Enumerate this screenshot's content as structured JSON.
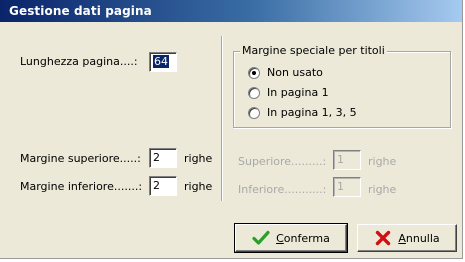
{
  "window": {
    "title": "Gestione dati pagina"
  },
  "left": {
    "page_length_label": "Lunghezza pagina....:",
    "page_length_value": "64",
    "top_margin_label": "Margine superiore.....:",
    "top_margin_value": "2",
    "top_margin_unit": "righe",
    "bottom_margin_label": "Margine inferiore.......:",
    "bottom_margin_value": "2",
    "bottom_margin_unit": "righe"
  },
  "right": {
    "group_title": "Margine speciale per titoli",
    "options": [
      {
        "label": "Non usato",
        "checked": true
      },
      {
        "label": "In pagina 1",
        "checked": false
      },
      {
        "label": "In pagina 1, 3, 5",
        "checked": false
      }
    ],
    "superiore_label": "Superiore.........:",
    "superiore_value": "1",
    "superiore_unit": "righe",
    "inferiore_label": "Inferiore...........:",
    "inferiore_value": "1",
    "inferiore_unit": "righe"
  },
  "buttons": {
    "confirm_first": "C",
    "confirm_rest": "onferma",
    "cancel_first": "A",
    "cancel_rest": "nnulla"
  },
  "colors": {
    "dialog_bg": "#ece9d8",
    "title_start": "#0a246a",
    "title_end": "#a6caf0",
    "check_green": "#2aa02a",
    "cross_red": "#d01010"
  },
  "icons": {
    "confirm": "check-icon",
    "cancel": "cross-icon"
  }
}
